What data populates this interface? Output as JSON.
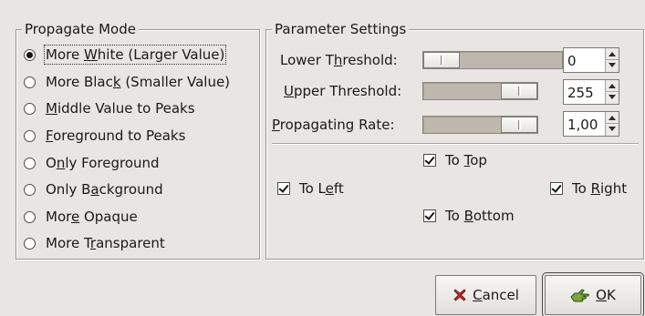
{
  "propagate_mode": {
    "title": "Propagate Mode",
    "options": [
      {
        "pre": "More ",
        "mn": "W",
        "post": "hite (Larger Value)",
        "selected": true
      },
      {
        "pre": "More Blac",
        "mn": "k",
        "post": " (Smaller Value)",
        "selected": false
      },
      {
        "pre": "",
        "mn": "M",
        "post": "iddle Value to Peaks",
        "selected": false
      },
      {
        "pre": "",
        "mn": "F",
        "post": "oreground to Peaks",
        "selected": false
      },
      {
        "pre": "O",
        "mn": "n",
        "post": "ly Foreground",
        "selected": false
      },
      {
        "pre": "Only B",
        "mn": "a",
        "post": "ckground",
        "selected": false
      },
      {
        "pre": "Mor",
        "mn": "e",
        "post": " Opaque",
        "selected": false
      },
      {
        "pre": "More T",
        "mn": "r",
        "post": "ansparent",
        "selected": false
      }
    ]
  },
  "parameter_settings": {
    "title": "Parameter Settings",
    "lower_threshold": {
      "pre": "Lower T",
      "mn": "h",
      "post": "reshold:",
      "value": "0",
      "level": 0
    },
    "upper_threshold": {
      "pre": "",
      "mn": "U",
      "post": "pper Threshold:",
      "value": "255",
      "level": 1
    },
    "propagating_rate": {
      "pre": "",
      "mn": "P",
      "post": "ropagating Rate:",
      "value": "1,00",
      "level": 1
    },
    "directions": {
      "top": {
        "pre": "To ",
        "mn": "T",
        "post": "op",
        "checked": true
      },
      "left": {
        "pre": "To L",
        "mn": "e",
        "post": "ft",
        "checked": true
      },
      "right": {
        "pre": "To ",
        "mn": "R",
        "post": "ight",
        "checked": true
      },
      "bottom": {
        "pre": "To ",
        "mn": "B",
        "post": "ottom",
        "checked": true
      }
    }
  },
  "buttons": {
    "cancel": {
      "pre": "",
      "mn": "C",
      "post": "ancel",
      "icon": "cancel-x-icon"
    },
    "ok": {
      "pre": "",
      "mn": "O",
      "post": "K",
      "icon": "ok-hand-icon"
    }
  },
  "colors": {
    "background": "#e8e5e2",
    "trough": "#bdb7ae",
    "cancel_icon": "#c8261b",
    "ok_icon": "#4e7a2c"
  }
}
